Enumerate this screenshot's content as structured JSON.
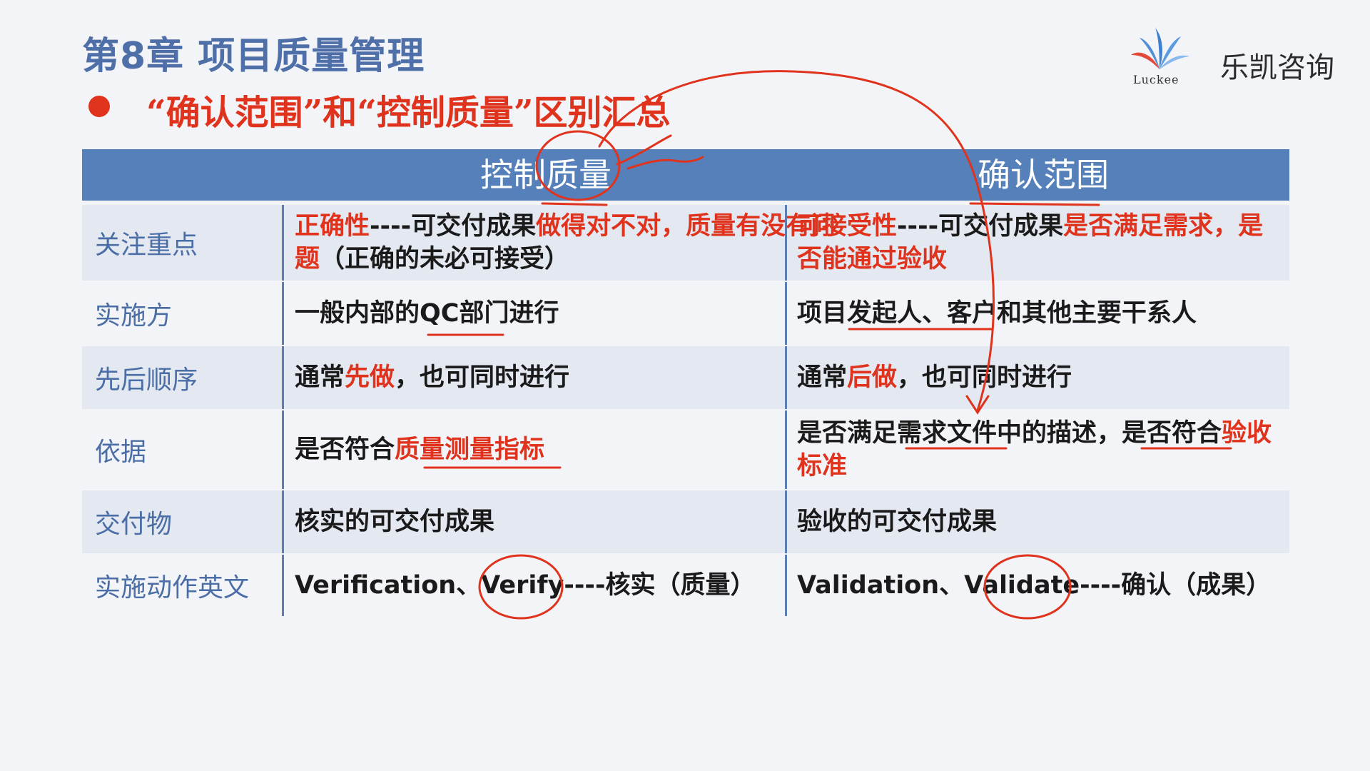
{
  "slide": {
    "chapter_title": "第8章 项目质量管理",
    "subtitle": "“确认范围”和“控制质量”区别汇总"
  },
  "brand": {
    "logo_word": "Luckee",
    "name": "乐凯咨询"
  },
  "colors": {
    "header_bar": "#5580b9",
    "accent_red": "#e0331d",
    "label_blue": "#4a6ea5",
    "row_shade": "#e3e8f1"
  },
  "table": {
    "headers": [
      "控制质量",
      "确认范围"
    ],
    "rows": [
      {
        "label": "关注重点",
        "left": [
          [
            "正确性",
            "red"
          ],
          [
            "----可交付成果",
            ""
          ],
          [
            "做得对不对，质量有没有问题",
            "red"
          ],
          [
            "（正确的未必可接受）",
            ""
          ]
        ],
        "right": [
          [
            "可接受性",
            "red"
          ],
          [
            "----可交付成果",
            ""
          ],
          [
            "是否满足需求，是否能通过验收",
            "red"
          ]
        ]
      },
      {
        "label": "实施方",
        "left": [
          [
            "一般内部的QC部门进行",
            ""
          ]
        ],
        "right": [
          [
            "项目发起人、客户和其他主要干系人",
            ""
          ]
        ]
      },
      {
        "label": "先后顺序",
        "left": [
          [
            "通常",
            ""
          ],
          [
            "先做",
            "red"
          ],
          [
            "，也可同时进行",
            ""
          ]
        ],
        "right": [
          [
            "通常",
            ""
          ],
          [
            "后做",
            "red"
          ],
          [
            "，也可同时进行",
            ""
          ]
        ]
      },
      {
        "label": "依据",
        "left": [
          [
            "是否符合",
            ""
          ],
          [
            "质量测量指标",
            "red"
          ]
        ],
        "right": [
          [
            "是否满足需求文件中的描述，是否符合",
            ""
          ],
          [
            "验收标准",
            "red"
          ]
        ]
      },
      {
        "label": "交付物",
        "left": [
          [
            "核实的可交付成果",
            ""
          ]
        ],
        "right": [
          [
            "验收的可交付成果",
            ""
          ]
        ]
      },
      {
        "label": "实施动作英文",
        "left": [
          [
            "Verification、Verify----核实（质量）",
            ""
          ]
        ],
        "right": [
          [
            "Validation、Validate----确认（成果）",
            ""
          ]
        ]
      }
    ]
  }
}
